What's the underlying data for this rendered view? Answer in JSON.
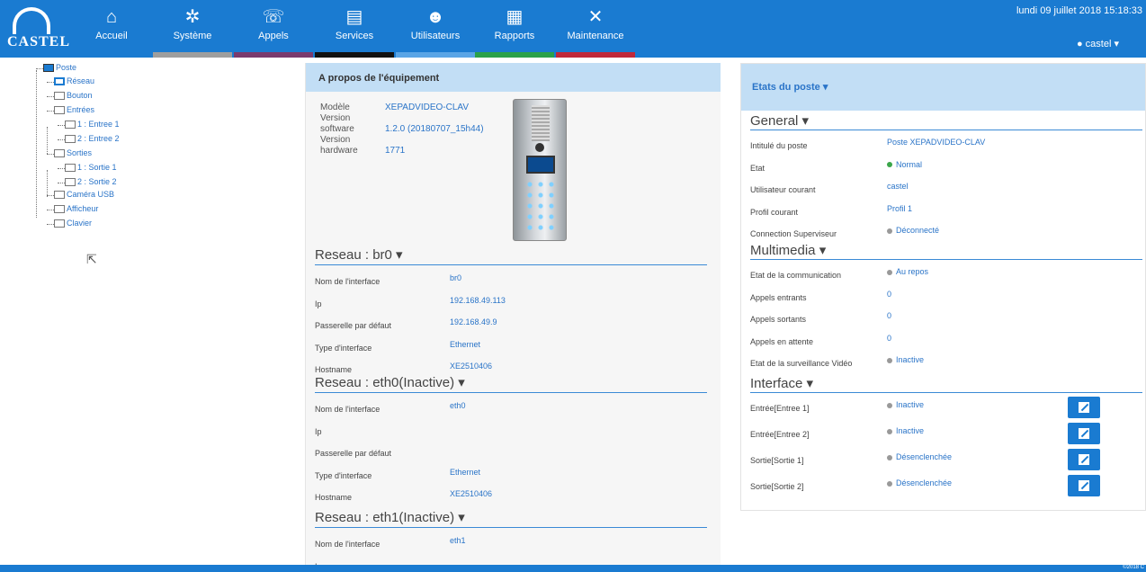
{
  "header": {
    "logo": "CASTEL",
    "date": "lundi 09 juillet 2018 15:18:33",
    "user": "castel",
    "nav": [
      {
        "label": "Accueil",
        "icon": "home-icon",
        "bar": "#1a7bd1"
      },
      {
        "label": "Système",
        "icon": "gears-icon",
        "bar": "#9e9e9e"
      },
      {
        "label": "Appels",
        "icon": "phone-icon",
        "bar": "#7a3b6e"
      },
      {
        "label": "Services",
        "icon": "document-icon",
        "bar": "#111111"
      },
      {
        "label": "Utilisateurs",
        "icon": "users-icon",
        "bar": "#5aa5e6"
      },
      {
        "label": "Rapports",
        "icon": "report-icon",
        "bar": "#2aa14a"
      },
      {
        "label": "Maintenance",
        "icon": "tools-icon",
        "bar": "#c0283a"
      }
    ]
  },
  "tree": {
    "items": [
      "Poste",
      "Réseau",
      "Bouton",
      "Entrées",
      "1 : Entree 1",
      "2 : Entree 2",
      "Sorties",
      "1 : Sortie 1",
      "2 : Sortie 2",
      "Caméra USB",
      "Afficheur",
      "Clavier"
    ]
  },
  "about": {
    "title": "A propos de l'équipement",
    "rows": [
      {
        "label": "Modèle",
        "value": "XEPADVIDEO-CLAV"
      },
      {
        "label": "Version software",
        "value": "1.2.0 (20180707_15h44)"
      },
      {
        "label": "Version hardware",
        "value": "1771"
      }
    ],
    "sections": [
      {
        "title": "Reseau : br0",
        "rows": [
          {
            "label": "Nom de l'interface",
            "value": "br0"
          },
          {
            "label": "Ip",
            "value": "192.168.49.113"
          },
          {
            "label": "Passerelle par défaut",
            "value": "192.168.49.9"
          },
          {
            "label": "Type d'interface",
            "value": "Ethernet"
          },
          {
            "label": "Hostname",
            "value": "XE2510406"
          }
        ]
      },
      {
        "title": "Reseau : eth0(Inactive)",
        "rows": [
          {
            "label": "Nom de l'interface",
            "value": "eth0"
          },
          {
            "label": "Ip",
            "value": ""
          },
          {
            "label": "Passerelle par défaut",
            "value": ""
          },
          {
            "label": "Type d'interface",
            "value": "Ethernet"
          },
          {
            "label": "Hostname",
            "value": "XE2510406"
          }
        ]
      },
      {
        "title": "Reseau : eth1(Inactive)",
        "rows": [
          {
            "label": "Nom de l'interface",
            "value": "eth1"
          },
          {
            "label": "Ip",
            "value": ""
          }
        ]
      }
    ]
  },
  "etats": {
    "title": "Etats du poste",
    "sections": [
      {
        "title": "General",
        "rows": [
          {
            "label": "Intitulé du poste",
            "value": "Poste XEPADVIDEO-CLAV",
            "dot": ""
          },
          {
            "label": "Etat",
            "value": "Normal",
            "dot": "green"
          },
          {
            "label": "Utilisateur courant",
            "value": "castel",
            "dot": ""
          },
          {
            "label": "Profil courant",
            "value": "Profil 1",
            "dot": ""
          },
          {
            "label": "Connection Superviseur",
            "value": "Déconnecté",
            "dot": "grey"
          }
        ]
      },
      {
        "title": "Multimedia",
        "rows": [
          {
            "label": "Etat de la communication",
            "value": "Au repos",
            "dot": "grey"
          },
          {
            "label": "Appels entrants",
            "value": "0",
            "dot": ""
          },
          {
            "label": "Appels sortants",
            "value": "0",
            "dot": ""
          },
          {
            "label": "Appels en attente",
            "value": "0",
            "dot": ""
          },
          {
            "label": "Etat de la surveillance Vidéo",
            "value": "Inactive",
            "dot": "grey"
          }
        ]
      },
      {
        "title": "Interface",
        "rows": [
          {
            "label": "Entrée[Entree 1]",
            "value": "Inactive",
            "dot": "grey"
          },
          {
            "label": "Entrée[Entree 2]",
            "value": "Inactive",
            "dot": "grey"
          },
          {
            "label": "Sortie[Sortie 1]",
            "value": "Désenclenchée",
            "dot": "grey"
          },
          {
            "label": "Sortie[Sortie 2]",
            "value": "Désenclenchée",
            "dot": "grey"
          }
        ]
      }
    ]
  },
  "footer": "©2018 C"
}
